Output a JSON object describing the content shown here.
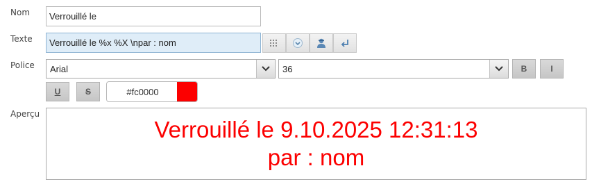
{
  "labels": {
    "name": "Nom",
    "text": "Texte",
    "font": "Police",
    "preview": "Aperçu"
  },
  "name_field": {
    "value": "Verrouillé le"
  },
  "text_field": {
    "value": "Verrouillé le %x %X \\npar : nom"
  },
  "text_buttons": [
    "grid-icon",
    "chevron-circle-icon",
    "user-icon",
    "return-arrow-icon"
  ],
  "font": {
    "family": "Arial",
    "size": "36",
    "bold_label": "B",
    "italic_label": "I",
    "underline_label": "U",
    "strike_label": "S",
    "color_hex": "#fc0000",
    "color": "#fc0000"
  },
  "preview": {
    "line1": "Verrouillé le 9.10.2025 12:31:13",
    "line2": "par : nom"
  }
}
